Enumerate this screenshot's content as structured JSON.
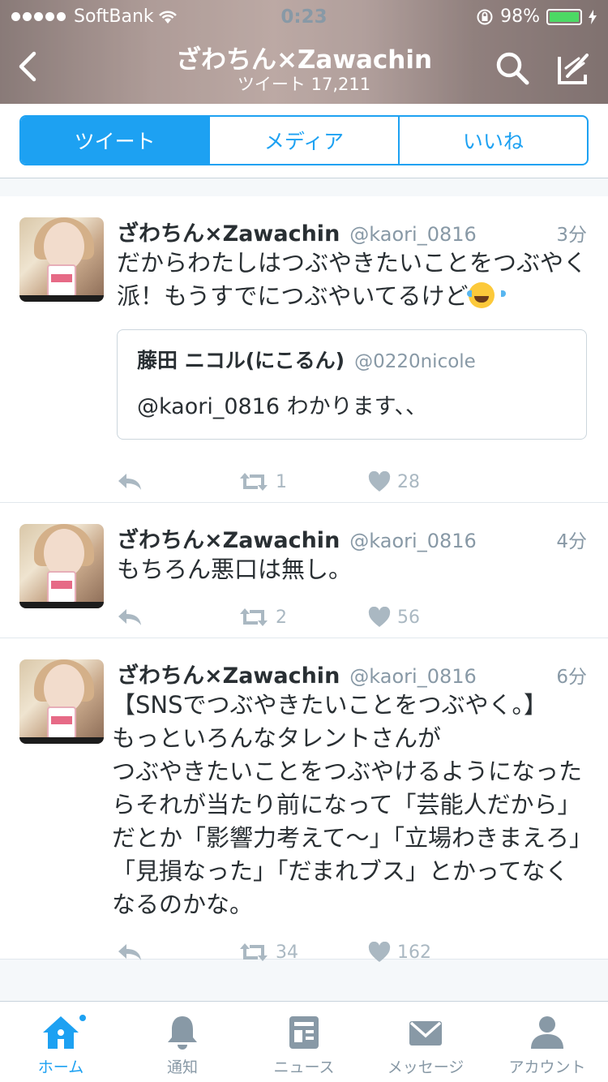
{
  "status_bar": {
    "carrier": "SoftBank",
    "time": "0:23",
    "battery": "98%",
    "battery_level": 0.98
  },
  "nav": {
    "title": "ざわちん×Zawachin",
    "subtitle": "ツイート 17,211"
  },
  "tabs": [
    {
      "label": "ツイート",
      "active": true
    },
    {
      "label": "メディア",
      "active": false
    },
    {
      "label": "いいね",
      "active": false
    }
  ],
  "tweets": [
    {
      "name": "ざわちん×Zawachin",
      "handle": "@kaori_0816",
      "time": "3分",
      "text": "だからわたしはつぶやきたいことをつぶやく派！もうすでにつぶやいてるけど",
      "emoji": "face-with-tears-of-joy",
      "quote": {
        "name": "藤田 ニコル(にこるん)",
        "handle": "@0220nicole",
        "text": "@kaori_0816 わかります、、"
      },
      "retweets": "1",
      "likes": "28"
    },
    {
      "name": "ざわちん×Zawachin",
      "handle": "@kaori_0816",
      "time": "4分",
      "text": "もちろん悪口は無し。",
      "retweets": "2",
      "likes": "56"
    },
    {
      "name": "ざわちん×Zawachin",
      "handle": "@kaori_0816",
      "time": "6分",
      "text": "【SNSでつぶやきたいことをつぶやく。】\nもっといろんなタレントさんが\nつぶやきたいことをつぶやけるようになったらそれが当たり前になって「芸能人だから」だとか「影響力考えて〜」「立場わきまえろ」「見損なった」「だまれブス」とかってなくなるのかな。",
      "retweets": "34",
      "likes": "162"
    }
  ],
  "bottom_tabs": [
    {
      "label": "ホーム",
      "icon": "home-icon",
      "active": true
    },
    {
      "label": "通知",
      "icon": "bell-icon",
      "active": false
    },
    {
      "label": "ニュース",
      "icon": "news-icon",
      "active": false
    },
    {
      "label": "メッセージ",
      "icon": "envelope-icon",
      "active": false
    },
    {
      "label": "アカウント",
      "icon": "person-icon",
      "active": false
    }
  ],
  "colors": {
    "accent": "#1da1f2",
    "muted": "#8899a6",
    "text": "#292f33"
  }
}
